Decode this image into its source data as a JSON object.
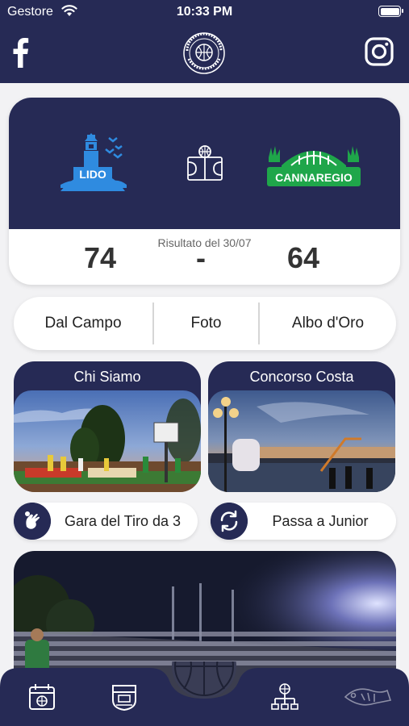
{
  "status_bar": {
    "carrier": "Gestore",
    "time": "10:33 PM"
  },
  "header": {
    "facebook_icon": "facebook-icon",
    "logo_text": "TORNEO dei SESTIERI VENEZIA",
    "instagram_icon": "instagram-icon"
  },
  "match": {
    "home_team": "LIDO",
    "away_team": "CANNAREGIO",
    "result_label": "Risultato del 30/07",
    "home_score": "74",
    "separator": "-",
    "away_score": "64"
  },
  "menu": {
    "items": [
      "Dal Campo",
      "Foto",
      "Albo d'Oro"
    ]
  },
  "cards": [
    {
      "title": "Chi Siamo"
    },
    {
      "title": "Concorso Costa"
    }
  ],
  "actions": [
    {
      "label": "Gara del Tiro da 3",
      "icon": "hand-icon"
    },
    {
      "label": "Passa a Junior",
      "icon": "switch-icon"
    }
  ],
  "tabbar": {
    "icons": [
      "calendar-icon",
      "team-shield-icon",
      "basketball-center-icon",
      "bracket-icon",
      "sponsor-fish-icon"
    ]
  },
  "colors": {
    "navy": "#262a55",
    "lido_blue": "#2f8be0",
    "cannaregio_green": "#1fa64a",
    "background": "#f2f2f4"
  }
}
